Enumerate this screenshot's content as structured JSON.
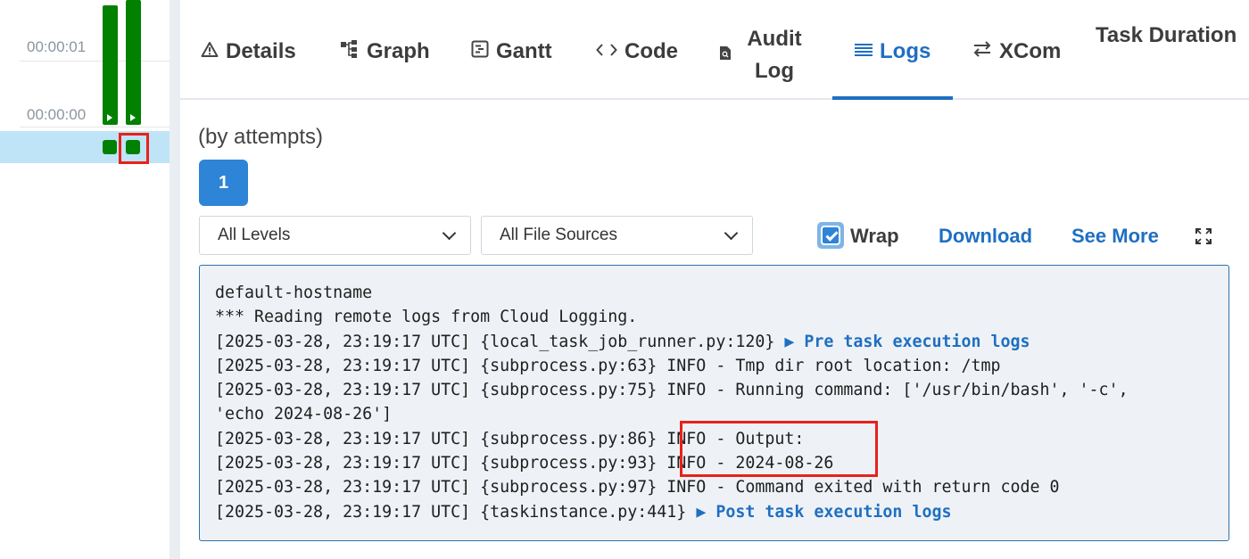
{
  "grid": {
    "ticks": [
      "00:00:01",
      "00:00:00"
    ]
  },
  "tabs": [
    {
      "id": "details",
      "label": "Details",
      "icon": "warning-triangle-icon"
    },
    {
      "id": "graph",
      "label": "Graph",
      "icon": "graph-nodes-icon"
    },
    {
      "id": "gantt",
      "label": "Gantt",
      "icon": "gantt-icon"
    },
    {
      "id": "code",
      "label": "Code",
      "icon": "code-brackets-icon"
    },
    {
      "id": "audit",
      "label": "Audit Log",
      "label_line1": "Audit",
      "label_line2": "Log",
      "icon": "file-search-icon"
    },
    {
      "id": "logs",
      "label": "Logs",
      "icon": "list-lines-icon",
      "active": true
    },
    {
      "id": "xcom",
      "label": "XCom",
      "icon": "swap-arrows-icon"
    },
    {
      "id": "taskdur",
      "label": "Task Duration"
    }
  ],
  "attempts": {
    "heading": "(by attempts)",
    "buttons": [
      "1"
    ]
  },
  "filters": {
    "levels": "All Levels",
    "sources": "All File Sources"
  },
  "controls": {
    "wrap_label": "Wrap",
    "wrap_checked": true,
    "download_label": "Download",
    "see_more_label": "See More",
    "expand_icon": "expand-arrows-icon"
  },
  "log": {
    "lines": [
      {
        "text": "default-hostname"
      },
      {
        "text": "*** Reading remote logs from Cloud Logging."
      },
      {
        "text": "[2025-03-28, 23:19:17 UTC] {local_task_job_runner.py:120} ",
        "group": "▶ Pre task execution logs"
      },
      {
        "text": "[2025-03-28, 23:19:17 UTC] {subprocess.py:63} INFO - Tmp dir root location: /tmp"
      },
      {
        "text": "[2025-03-28, 23:19:17 UTC] {subprocess.py:75} INFO - Running command: ['/usr/bin/bash', '-c',"
      },
      {
        "text": "'echo 2024-08-26']"
      },
      {
        "text": "[2025-03-28, 23:19:17 UTC] {subprocess.py:86} INFO - Output:"
      },
      {
        "text": "[2025-03-28, 23:19:17 UTC] {subprocess.py:93} INFO - 2024-08-26"
      },
      {
        "text": "[2025-03-28, 23:19:17 UTC] {subprocess.py:97} INFO - Command exited with return code 0"
      },
      {
        "text": "[2025-03-28, 23:19:17 UTC] {taskinstance.py:441} ",
        "group": "▶ Post task execution logs"
      }
    ]
  },
  "colors": {
    "accent": "#1f6fc1",
    "success": "#028000",
    "highlight": "#e8211b",
    "selected_row": "#bfe3f7"
  }
}
